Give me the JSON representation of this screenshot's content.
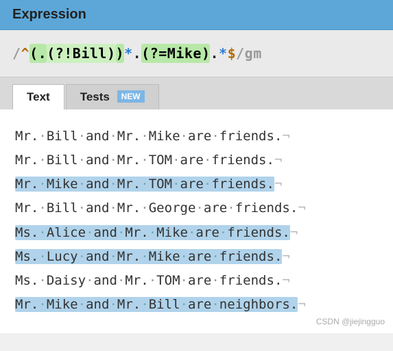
{
  "header": {
    "title": "Expression"
  },
  "expression": {
    "parts": [
      {
        "text": "/",
        "cls": "t-delim"
      },
      {
        "text": "^",
        "cls": "t-anchor"
      },
      {
        "text": "(.",
        "cls": "t-group1"
      },
      {
        "text": "(?!Bill)",
        "cls": "t-group2"
      },
      {
        "text": ")",
        "cls": "t-group1"
      },
      {
        "text": "*",
        "cls": "t-quant"
      },
      {
        "text": ".",
        "cls": "t-plain"
      },
      {
        "text": "(?=Mike)",
        "cls": "t-group1"
      },
      {
        "text": ".",
        "cls": "t-plain"
      },
      {
        "text": "*",
        "cls": "t-quant"
      },
      {
        "text": "$",
        "cls": "t-anchor"
      },
      {
        "text": "/",
        "cls": "t-delim"
      },
      {
        "text": "gm",
        "cls": "t-flag"
      }
    ]
  },
  "tabs": {
    "text": "Text",
    "tests": "Tests",
    "badge": "NEW"
  },
  "test_lines": [
    {
      "text": "Mr. Bill and Mr. Mike are friends.",
      "match": false
    },
    {
      "text": "Mr. Bill and Mr. TOM are friends.",
      "match": false
    },
    {
      "text": "Mr. Mike and Mr. TOM are friends.",
      "match": true
    },
    {
      "text": "Mr. Bill and Mr. George are friends.",
      "match": false
    },
    {
      "text": "Ms. Alice and Mr. Mike are friends.",
      "match": true
    },
    {
      "text": "Ms. Lucy and Mr. Mike are friends.",
      "match": true
    },
    {
      "text": "Ms. Daisy and Mr. TOM are friends.",
      "match": false
    },
    {
      "text": "Mr. Mike and Mr. Bill are neighbors.",
      "match": true
    }
  ],
  "watermark": "CSDN @jiejingguo"
}
